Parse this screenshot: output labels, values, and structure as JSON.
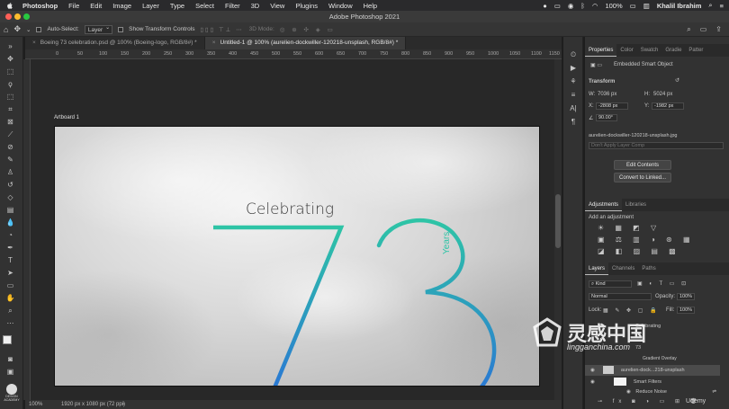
{
  "menubar": {
    "items": [
      "Photoshop",
      "File",
      "Edit",
      "Image",
      "Layer",
      "Type",
      "Select",
      "Filter",
      "3D",
      "View",
      "Plugins",
      "Window",
      "Help"
    ],
    "battery": "100%",
    "user": "Khalil Ibrahim"
  },
  "window": {
    "title": "Adobe Photoshop 2021"
  },
  "options": {
    "auto_select_label": "Auto-Select:",
    "auto_select_value": "Layer",
    "show_transform_label": "Show Transform Controls",
    "mode_3d_label": "3D Mode:"
  },
  "tabs": [
    {
      "label": "Boeing 73 celebration.psd @ 100% (Boeing-logo, RGB/8#) *",
      "active": false
    },
    {
      "label": "Untitled-1 @ 100% (aurelien-dockwiller-120218-unsplash, RGB/8#) *",
      "active": true
    }
  ],
  "ruler": {
    "ticks": [
      "0",
      "50",
      "100",
      "150",
      "200",
      "250",
      "300",
      "350",
      "400",
      "450",
      "500",
      "550",
      "600",
      "650",
      "700",
      "750",
      "800",
      "850",
      "900",
      "950",
      "1000",
      "1050",
      "1100",
      "1150",
      "1200",
      "1250"
    ]
  },
  "artboard": {
    "label": "Artboard 1",
    "heading": "Celebrating",
    "big_number": "73",
    "vertical_word": "Years"
  },
  "status": {
    "zoom": "100%",
    "doc_info": "1920 px x 1080 px (72 ppi)"
  },
  "properties": {
    "tabs": [
      "Properties",
      "Color",
      "Swatch",
      "Gradie",
      "Patter"
    ],
    "object_type": "Embedded Smart Object",
    "transform_label": "Transform",
    "w_label": "W:",
    "w_value": "7036 px",
    "h_label": "H:",
    "h_value": "5024 px",
    "x_label": "X:",
    "x_value": "-2808 px",
    "y_label": "Y:",
    "y_value": "-1982 px",
    "angle_value": "90.00°",
    "filename": "aurelien-dockwiller-120218-unsplash.jpg",
    "layer_comp_placeholder": "Don't Apply Layer Comp",
    "edit_contents": "Edit Contents",
    "convert_linked": "Convert to Linked..."
  },
  "adjustments": {
    "tabs": [
      "Adjustments",
      "Libraries"
    ],
    "add_label": "Add an adjustment"
  },
  "layers": {
    "tabs": [
      "Layers",
      "Channels",
      "Paths"
    ],
    "kind": "Kind",
    "blend_mode": "Normal",
    "opacity_label": "Opacity:",
    "opacity_value": "100%",
    "lock_label": "Lock:",
    "fill_label": "Fill:",
    "fill_value": "100%",
    "rows": [
      "Celebrating",
      "73",
      "Gradient Overlay",
      "aurelien-dock...218-unsplash",
      "Smart Filters",
      "Reduce Noise"
    ]
  },
  "watermark": {
    "cn_text": "灵感中国",
    "url": "lingganchina.com",
    "udemy": "Udemy",
    "badge": "DESIGN ACADEMY"
  },
  "colors": {
    "teal": "#2ec4a6",
    "blue": "#2a74d6",
    "panel": "#323232",
    "canvas": "#282828"
  }
}
